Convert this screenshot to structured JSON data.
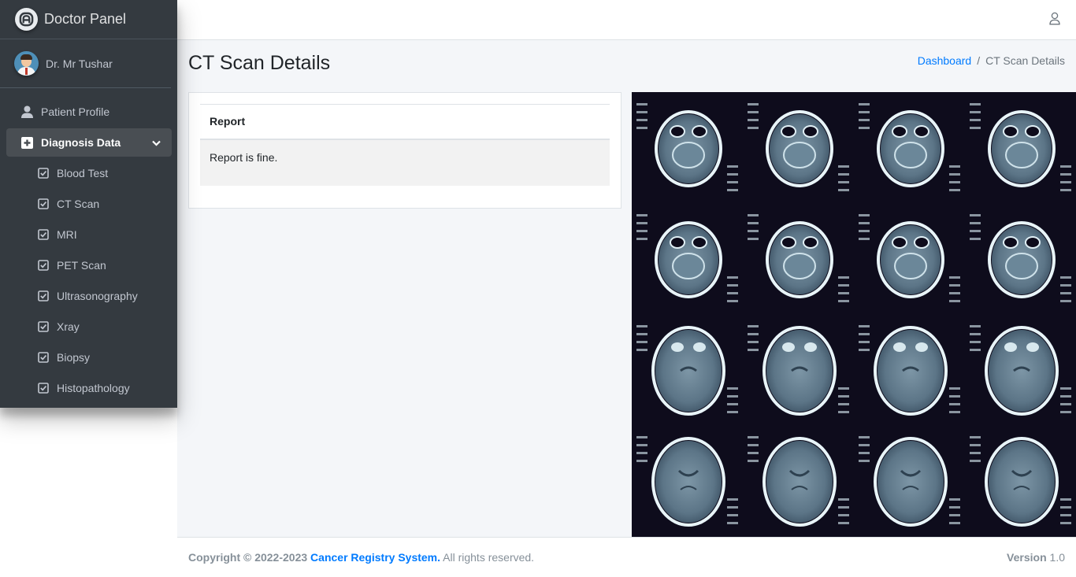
{
  "brand": {
    "title": "Doctor Panel",
    "logo_icon": "a-logo-icon"
  },
  "user": {
    "name": "Dr. Mr Tushar"
  },
  "sidebar": {
    "items": [
      {
        "label": "Patient Profile",
        "icon": "user-icon"
      },
      {
        "label": "Diagnosis Data",
        "icon": "plus-square-icon",
        "active": true
      }
    ],
    "sub_items": [
      {
        "label": "Blood Test"
      },
      {
        "label": "CT Scan"
      },
      {
        "label": "MRI"
      },
      {
        "label": "PET Scan"
      },
      {
        "label": "Ultrasonography"
      },
      {
        "label": "Xray"
      },
      {
        "label": "Biopsy"
      },
      {
        "label": "Histopathology"
      }
    ]
  },
  "page": {
    "title": "CT Scan Details",
    "breadcrumb": {
      "home": "Dashboard",
      "separator": "/",
      "current": "CT Scan Details"
    }
  },
  "report": {
    "header": "Report",
    "text": "Report is fine."
  },
  "footer": {
    "copyright_prefix": "Copyright © 2022-2023",
    "org": "Cancer Registry System.",
    "rights": "All rights reserved.",
    "version_label": "Version",
    "version": "1.0"
  },
  "colors": {
    "sidebar_bg": "#343a40",
    "link": "#007bff",
    "content_bg": "#f4f6f9"
  }
}
